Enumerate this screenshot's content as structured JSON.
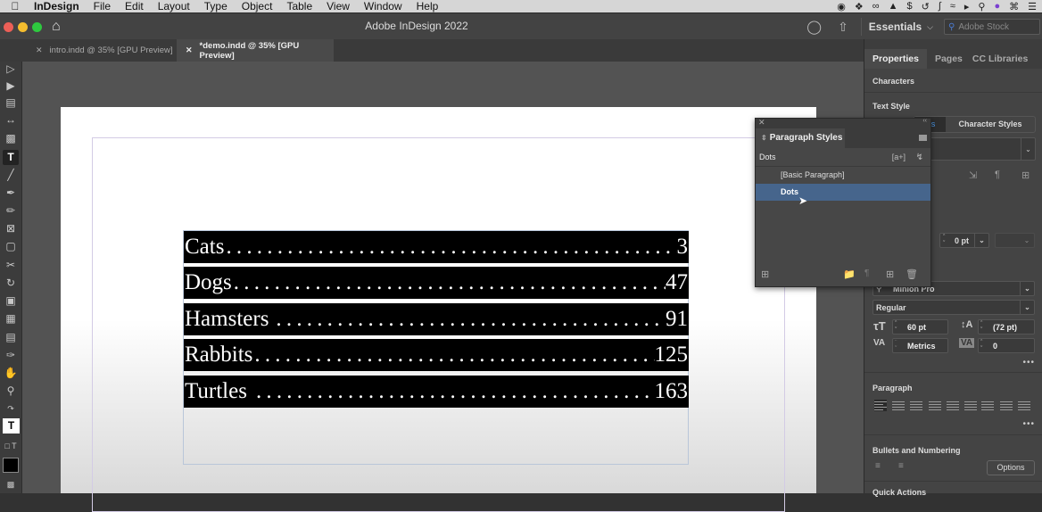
{
  "menubar": {
    "app": "InDesign",
    "items": [
      "File",
      "Edit",
      "Layout",
      "Type",
      "Object",
      "Table",
      "View",
      "Window",
      "Help"
    ]
  },
  "window": {
    "title": "Adobe InDesign 2022",
    "workspace": "Essentials",
    "stock_placeholder": "Adobe Stock"
  },
  "doc_tabs": [
    {
      "label": "intro.indd @ 35% [GPU Preview]",
      "active": false
    },
    {
      "label": "*demo.indd @ 35% [GPU Preview]",
      "active": true
    }
  ],
  "document": {
    "rows": [
      {
        "label": "Cats",
        "value": "3"
      },
      {
        "label": "Dogs",
        "value": "47"
      },
      {
        "label": "Hamsters",
        "value": "91"
      },
      {
        "label": "Rabbits",
        "value": "125"
      },
      {
        "label": "Turtles",
        "value": "163"
      }
    ],
    "leader": "..........................................................."
  },
  "paragraph_styles_panel": {
    "title": "Paragraph Styles",
    "current": "Dots",
    "new_from_selection_icon": "[a+]",
    "items": [
      {
        "label": "[Basic Paragraph]",
        "selected": false
      },
      {
        "label": "Dots",
        "selected": true
      }
    ]
  },
  "properties_panel": {
    "tabs": [
      "Properties",
      "Pages",
      "CC Libraries"
    ],
    "characters_label": "Characters",
    "text_style_label": "Text Style",
    "style_tabs": [
      "les",
      "Character Styles"
    ],
    "indent_value": "0 pt",
    "font_family": "Minion Pro",
    "font_style": "Regular",
    "font_size": "60 pt",
    "leading": "(72 pt)",
    "kerning": "Metrics",
    "tracking": "0",
    "paragraph_label": "Paragraph",
    "bullets_label": "Bullets and Numbering",
    "options_button": "Options",
    "quick_actions_label": "Quick Actions"
  }
}
